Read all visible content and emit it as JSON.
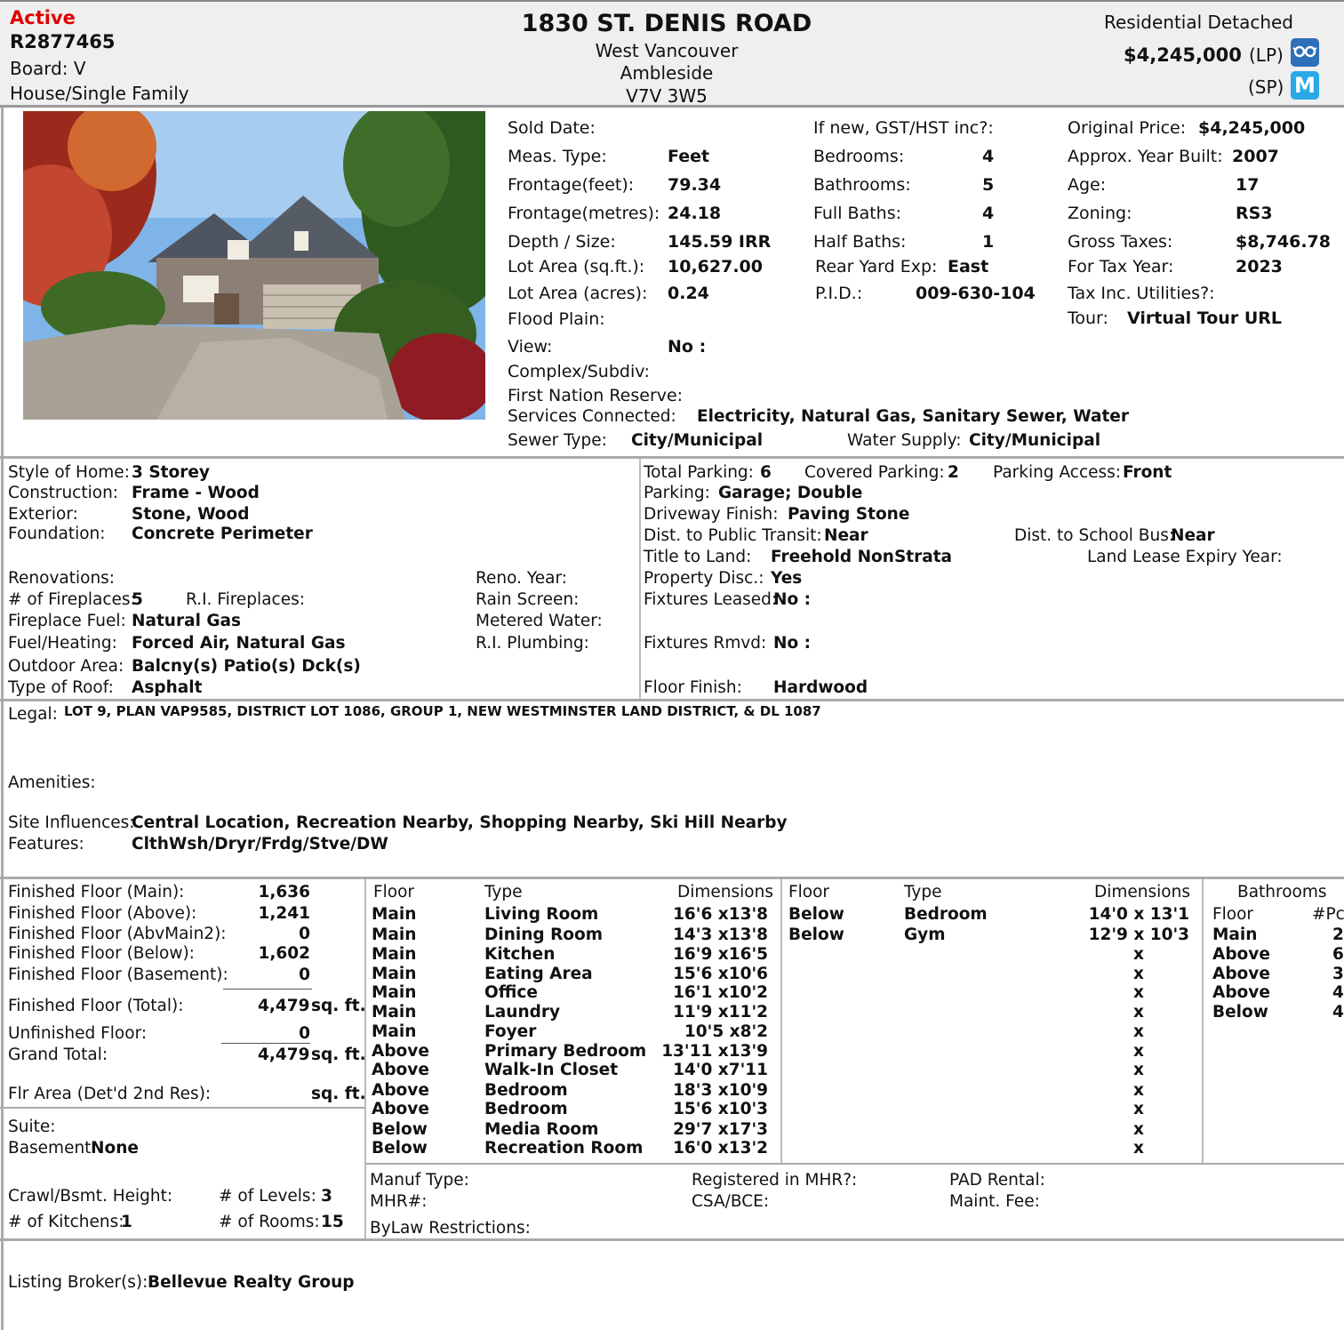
{
  "header": {
    "status": "Active",
    "mls": "R2877465",
    "board": "Board: V",
    "type": "House/Single Family",
    "address": "1830 ST. DENIS ROAD",
    "city": "West Vancouver",
    "area": "Ambleside",
    "postal": "V7V 3W5",
    "class": "Residential Detached",
    "list_price": "$4,245,000",
    "lp_label": "(LP)",
    "sp_label": "(SP)",
    "m_letter": "M",
    "status_color": "#e00000"
  },
  "photo": {
    "alt": "House photo"
  },
  "details_col1": [
    {
      "label": "Sold Date:",
      "value": ""
    },
    {
      "label": "Meas. Type:",
      "value": "Feet"
    },
    {
      "label": "Frontage(feet):",
      "value": "79.34"
    },
    {
      "label": "Frontage(metres):",
      "value": "24.18"
    },
    {
      "label": "Depth / Size:",
      "value": "145.59 IRR"
    },
    {
      "label": "Lot Area (sq.ft.):",
      "value": "10,627.00"
    },
    {
      "label": "Lot Area (acres):",
      "value": "0.24"
    },
    {
      "label": "Flood Plain:",
      "value": ""
    },
    {
      "label": "View:",
      "value": "No  :"
    },
    {
      "label": "Complex/Subdiv:",
      "value": ""
    },
    {
      "label": "First Nation Reserve:",
      "value": ""
    }
  ],
  "details_col2": [
    {
      "label": "If new, GST/HST inc?:",
      "value": ""
    },
    {
      "label": "Bedrooms:",
      "value": "4"
    },
    {
      "label": "Bathrooms:",
      "value": "5"
    },
    {
      "label": "Full Baths:",
      "value": "4"
    },
    {
      "label": "Half Baths:",
      "value": "1"
    },
    {
      "label": "Rear Yard Exp:",
      "value": "East"
    },
    {
      "label": "P.I.D.:",
      "value": "009-630-104"
    }
  ],
  "details_col3": [
    {
      "label": "Original Price:",
      "value": "$4,245,000"
    },
    {
      "label": "Approx. Year Built:",
      "value": "2007"
    },
    {
      "label": "Age:",
      "value": "17"
    },
    {
      "label": "Zoning:",
      "value": "RS3"
    },
    {
      "label": "Gross Taxes:",
      "value": "$8,746.78"
    },
    {
      "label": "For Tax Year:",
      "value": "2023"
    },
    {
      "label": "Tax Inc. Utilities?:",
      "value": ""
    },
    {
      "label": "Tour:",
      "value": "Virtual Tour URL"
    }
  ],
  "services": {
    "label": "Services Connected:",
    "value": "Electricity, Natural Gas, Sanitary Sewer, Water"
  },
  "sewer": {
    "label": "Sewer Type:",
    "value": "City/Municipal"
  },
  "water": {
    "label": "Water Supply:",
    "value": "City/Municipal"
  },
  "style": [
    {
      "label": "Style of Home:",
      "value": "3 Storey"
    },
    {
      "label": "Construction:",
      "value": "Frame - Wood"
    },
    {
      "label": "Exterior:",
      "value": "Stone, Wood"
    },
    {
      "label": "Foundation:",
      "value": "Concrete Perimeter"
    }
  ],
  "reno": {
    "renovations": "Renovations:",
    "fireplaces_label": "# of Fireplaces:",
    "fireplaces": "5",
    "ri_fireplaces": "R.I. Fireplaces:",
    "fuel_label": "Fireplace Fuel:",
    "fuel": "Natural Gas",
    "heating_label": "Fuel/Heating:",
    "heating": "Forced Air, Natural Gas",
    "outdoor_label": "Outdoor Area:",
    "outdoor": "Balcny(s) Patio(s) Dck(s)",
    "roof_label": "Type of Roof:",
    "roof": "Asphalt",
    "reno_year": "Reno. Year:",
    "rain_screen": "Rain Screen:",
    "metered_water": "Metered Water:",
    "ri_plumbing": "R.I. Plumbing:"
  },
  "parking": {
    "total_label": "Total Parking:",
    "total": "6",
    "covered_label": "Covered Parking:",
    "covered": "2",
    "access_label": "Parking Access:",
    "access": "Front",
    "parking_label": "Parking:",
    "parking": "Garage; Double",
    "driveway_label": "Driveway Finish:",
    "driveway": "Paving Stone",
    "transit_label": "Dist. to Public Transit:",
    "transit": "Near",
    "schoolbus_label": "Dist. to School Bus:",
    "schoolbus": "Near",
    "title_label": "Title to Land:",
    "title": "Freehold NonStrata",
    "lease_label": "Land Lease Expiry Year:",
    "disc_label": "Property Disc.:",
    "disc": "Yes",
    "fixleased_label": "Fixtures Leased:",
    "fixleased": "No  :",
    "fixrmvd_label": "Fixtures Rmvd:",
    "fixrmvd": "No  :",
    "floor_label": "Floor Finish:",
    "floor": "Hardwood"
  },
  "legal": {
    "label": "Legal:",
    "value": "LOT 9, PLAN VAP9585, DISTRICT LOT 1086, GROUP 1, NEW WESTMINSTER LAND DISTRICT, & DL 1087"
  },
  "amenities": {
    "label": "Amenities:",
    "value": ""
  },
  "site": {
    "label": "Site Influences:",
    "value": "Central Location, Recreation Nearby, Shopping Nearby, Ski Hill Nearby"
  },
  "features": {
    "label": "Features:",
    "value": "ClthWsh/Dryr/Frdg/Stve/DW"
  },
  "areas": [
    {
      "label": "Finished Floor (Main):",
      "value": "1,636"
    },
    {
      "label": "Finished Floor (Above):",
      "value": "1,241"
    },
    {
      "label": "Finished Floor (AbvMain2):",
      "value": "0"
    },
    {
      "label": "Finished Floor (Below):",
      "value": "1,602"
    },
    {
      "label": "Finished Floor (Basement):",
      "value": "0"
    }
  ],
  "area_total": {
    "label": "Finished Floor (Total):",
    "value": "4,479",
    "unit": "sq. ft."
  },
  "unfinished": {
    "label": "Unfinished Floor:",
    "value": "0"
  },
  "grand_total": {
    "label": "Grand Total:",
    "value": "4,479",
    "unit": "sq. ft."
  },
  "flr_area": {
    "label": "Flr Area (Det'd 2nd Res):",
    "unit": "sq. ft."
  },
  "suite": {
    "label": "Suite:"
  },
  "basement": {
    "label": "Basement:",
    "value": "None"
  },
  "crawl": {
    "label": "Crawl/Bsmt. Height:"
  },
  "levels": {
    "label": "# of Levels:",
    "value": "3"
  },
  "kitchens": {
    "label": "# of Kitchens:",
    "value": "1"
  },
  "rooms_count": {
    "label": "# of Rooms:",
    "value": "15"
  },
  "room_headers": {
    "floor": "Floor",
    "type": "Type",
    "dims": "Dimensions"
  },
  "rooms1": [
    {
      "floor": "Main",
      "type": "Living Room",
      "dims": "16'6 x13'8"
    },
    {
      "floor": "Main",
      "type": "Dining Room",
      "dims": "14'3 x13'8"
    },
    {
      "floor": "Main",
      "type": "Kitchen",
      "dims": "16'9 x16'5"
    },
    {
      "floor": "Main",
      "type": "Eating Area",
      "dims": "15'6 x10'6"
    },
    {
      "floor": "Main",
      "type": "Office",
      "dims": "16'1 x10'2"
    },
    {
      "floor": "Main",
      "type": "Laundry",
      "dims": "11'9 x11'2"
    },
    {
      "floor": "Main",
      "type": "Foyer",
      "dims": "10'5 x8'2"
    },
    {
      "floor": "Above",
      "type": "Primary Bedroom",
      "dims": "13'11 x13'9"
    },
    {
      "floor": "Above",
      "type": "Walk-In Closet",
      "dims": "14'0 x7'11"
    },
    {
      "floor": "Above",
      "type": "Bedroom",
      "dims": "18'3 x10'9"
    },
    {
      "floor": "Above",
      "type": "Bedroom",
      "dims": "15'6 x10'3"
    },
    {
      "floor": "Below",
      "type": "Media Room",
      "dims": "29'7 x17'3"
    },
    {
      "floor": "Below",
      "type": "Recreation Room",
      "dims": "16'0 x13'2"
    }
  ],
  "rooms2": [
    {
      "floor": "Below",
      "type": "Bedroom",
      "dims": "14'0 x 13'1"
    },
    {
      "floor": "Below",
      "type": "Gym",
      "dims": "12'9 x 10'3"
    },
    {
      "floor": "",
      "type": "",
      "dims": "x"
    },
    {
      "floor": "",
      "type": "",
      "dims": "x"
    },
    {
      "floor": "",
      "type": "",
      "dims": "x"
    },
    {
      "floor": "",
      "type": "",
      "dims": "x"
    },
    {
      "floor": "",
      "type": "",
      "dims": "x"
    },
    {
      "floor": "",
      "type": "",
      "dims": "x"
    },
    {
      "floor": "",
      "type": "",
      "dims": "x"
    },
    {
      "floor": "",
      "type": "",
      "dims": "x"
    },
    {
      "floor": "",
      "type": "",
      "dims": "x"
    },
    {
      "floor": "",
      "type": "",
      "dims": "x"
    },
    {
      "floor": "",
      "type": "",
      "dims": "x"
    }
  ],
  "bathrooms": {
    "title": "Bathrooms",
    "floor_h": "Floor",
    "pcs_h": "#Pc",
    "rows": [
      {
        "floor": "Main",
        "pcs": "2"
      },
      {
        "floor": "Above",
        "pcs": "6"
      },
      {
        "floor": "Above",
        "pcs": "3"
      },
      {
        "floor": "Above",
        "pcs": "4"
      },
      {
        "floor": "Below",
        "pcs": "4"
      }
    ]
  },
  "manuf": {
    "manuf_type": "Manuf Type:",
    "mhr": "MHR#:",
    "bylaw": "ByLaw Restrictions:",
    "registered": "Registered in MHR?:",
    "csa": "CSA/BCE:",
    "pad": "PAD Rental:",
    "maint": "Maint. Fee:"
  },
  "broker": {
    "label": "Listing Broker(s):",
    "value": "Bellevue Realty Group"
  }
}
